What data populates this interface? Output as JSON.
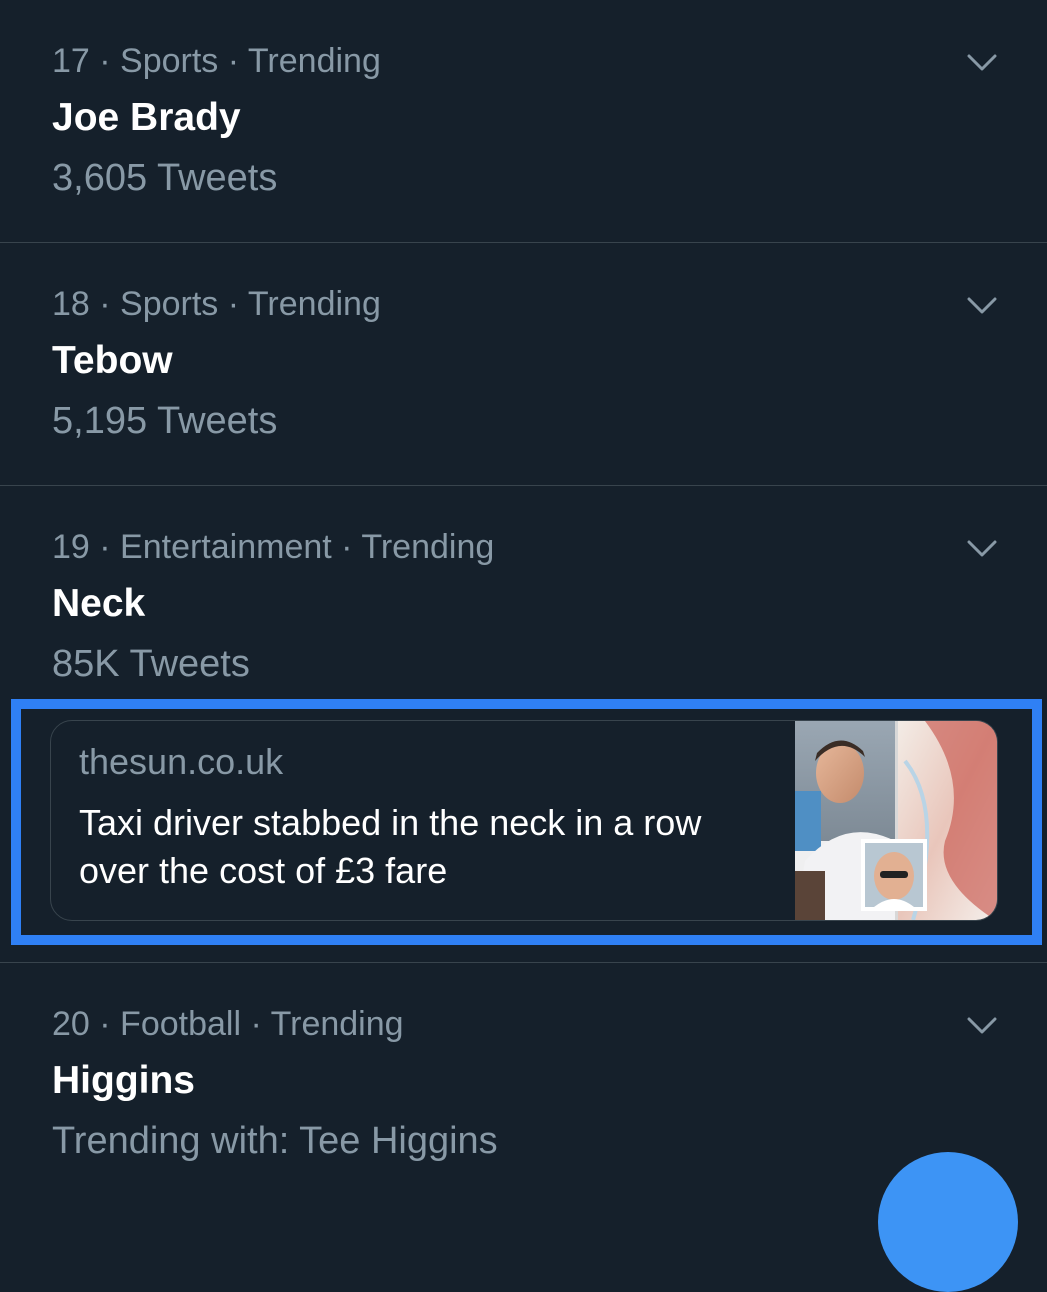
{
  "trends": [
    {
      "rank": "17",
      "category": "Sports",
      "status": "Trending",
      "title": "Joe Brady",
      "count": "3,605 Tweets"
    },
    {
      "rank": "18",
      "category": "Sports",
      "status": "Trending",
      "title": "Tebow",
      "count": "5,195 Tweets"
    },
    {
      "rank": "19",
      "category": "Entertainment",
      "status": "Trending",
      "title": "Neck",
      "count": "85K Tweets",
      "card": {
        "domain": "thesun.co.uk",
        "headline": "Taxi driver stabbed in the neck in a row over the cost of £3 fare"
      }
    },
    {
      "rank": "20",
      "category": "Football",
      "status": "Trending",
      "title": "Higgins",
      "count": "Trending with: Tee Higgins"
    }
  ],
  "separator": " · ",
  "icons": {
    "more": "chevron-down-icon",
    "compose": "compose-fab"
  },
  "colors": {
    "background": "#15202b",
    "secondary_text": "#8899a6",
    "divider": "#38444d",
    "highlight": "#2f80f5",
    "fab": "#3d94f5"
  }
}
